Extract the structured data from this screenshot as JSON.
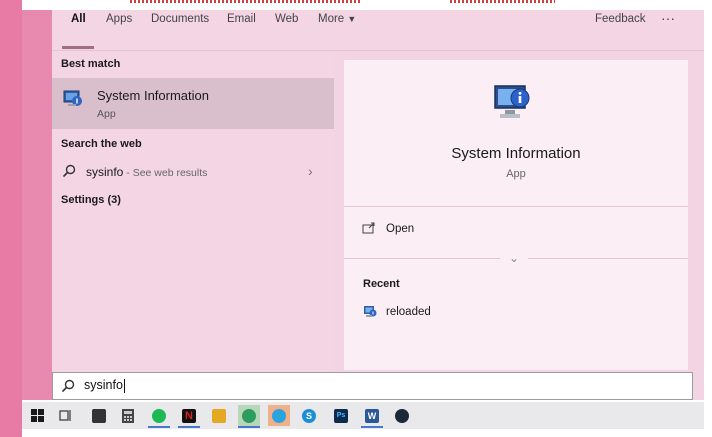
{
  "nav": {
    "tabs": [
      "All",
      "Apps",
      "Documents",
      "Email",
      "Web",
      "More"
    ],
    "feedback": "Feedback",
    "ellipsis": "···"
  },
  "left": {
    "best_match_heading": "Best match",
    "best_match": {
      "title": "System Information",
      "subtitle": "App"
    },
    "search_web_heading": "Search the web",
    "web_query": "sysinfo",
    "web_hint": " - See web results",
    "settings_heading": "Settings (3)"
  },
  "right": {
    "app_title": "System Information",
    "app_subtitle": "App",
    "open_label": "Open",
    "recent_heading": "Recent",
    "recent_items": [
      "reloaded"
    ]
  },
  "search": {
    "value": "sysinfo"
  },
  "taskbar": {
    "icons": [
      {
        "name": "windows-start-icon",
        "color": "#1a1a1a"
      },
      {
        "name": "task-view-icon",
        "color": "#333333"
      },
      {
        "name": "app-icon-1",
        "color": "#333333"
      },
      {
        "name": "calculator-icon",
        "color": "#444444"
      },
      {
        "name": "spotify-icon",
        "color": "#1db954"
      },
      {
        "name": "netflix-icon",
        "color": "#d81f26"
      },
      {
        "name": "file-explorer-icon",
        "color": "#e5a823"
      },
      {
        "name": "edge-icon",
        "color": "#2d9c5c"
      },
      {
        "name": "telegram-icon",
        "color": "#2aa3df"
      },
      {
        "name": "skype-icon",
        "color": "#1a8fd6"
      },
      {
        "name": "photoshop-icon",
        "color": "#0c2b4d"
      },
      {
        "name": "word-icon",
        "color": "#2b5797"
      },
      {
        "name": "steam-icon",
        "color": "#1b2838"
      }
    ]
  }
}
